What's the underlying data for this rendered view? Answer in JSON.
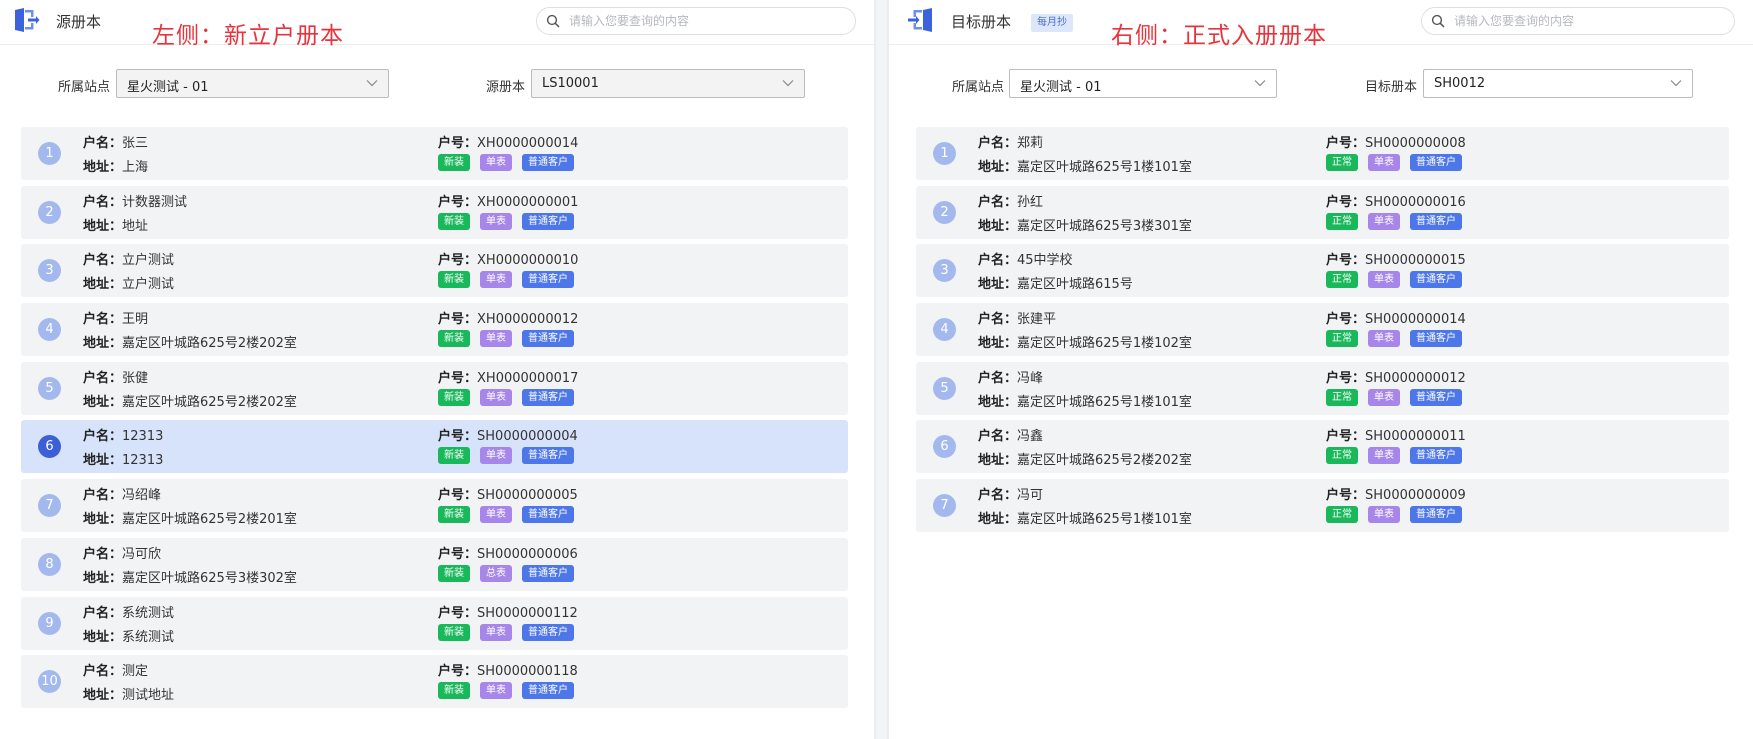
{
  "colors": {
    "annotation": "#e8333c",
    "status_tag": "#19b85a",
    "meter_tag": "#a786ea",
    "customer_tag": "#4d76e8",
    "selected_row": "#d6e3fb"
  },
  "labels": {
    "name": "户名：",
    "address": "地址：",
    "account": "户号："
  },
  "left": {
    "title": "源册本",
    "annotation": "左侧：新立户册本",
    "search_placeholder": "请输入您要查询的内容",
    "station_label": "所属站点",
    "station_value": "星火测试 - 01",
    "book_label": "源册本",
    "book_value": "LS10001",
    "rows": [
      {
        "index": "1",
        "name": "张三",
        "address": "上海",
        "account": "XH0000000014",
        "status": "新装",
        "meter": "单表",
        "customer": "普通客户",
        "selected": false
      },
      {
        "index": "2",
        "name": "计数器测试",
        "address": "地址",
        "account": "XH0000000001",
        "status": "新装",
        "meter": "单表",
        "customer": "普通客户",
        "selected": false
      },
      {
        "index": "3",
        "name": "立户测试",
        "address": "立户测试",
        "account": "XH0000000010",
        "status": "新装",
        "meter": "单表",
        "customer": "普通客户",
        "selected": false
      },
      {
        "index": "4",
        "name": "王明",
        "address": "嘉定区叶城路625号2楼202室",
        "account": "XH0000000012",
        "status": "新装",
        "meter": "单表",
        "customer": "普通客户",
        "selected": false
      },
      {
        "index": "5",
        "name": "张健",
        "address": "嘉定区叶城路625号2楼202室",
        "account": "XH0000000017",
        "status": "新装",
        "meter": "单表",
        "customer": "普通客户",
        "selected": false
      },
      {
        "index": "6",
        "name": "12313",
        "address": "12313",
        "account": "SH0000000004",
        "status": "新装",
        "meter": "单表",
        "customer": "普通客户",
        "selected": true
      },
      {
        "index": "7",
        "name": "冯绍峰",
        "address": "嘉定区叶城路625号2楼201室",
        "account": "SH0000000005",
        "status": "新装",
        "meter": "单表",
        "customer": "普通客户",
        "selected": false
      },
      {
        "index": "8",
        "name": "冯可欣",
        "address": "嘉定区叶城路625号3楼302室",
        "account": "SH0000000006",
        "status": "新装",
        "meter": "总表",
        "customer": "普通客户",
        "selected": false
      },
      {
        "index": "9",
        "name": "系统测试",
        "address": "系统测试",
        "account": "SH0000000112",
        "status": "新装",
        "meter": "单表",
        "customer": "普通客户",
        "selected": false
      },
      {
        "index": "10",
        "name": "测定",
        "address": "测试地址",
        "account": "SH0000000118",
        "status": "新装",
        "meter": "单表",
        "customer": "普通客户",
        "selected": false
      }
    ]
  },
  "right": {
    "title": "目标册本",
    "mode_tag": "每月抄",
    "annotation": "右侧：正式入册册本",
    "search_placeholder": "请输入您要查询的内容",
    "station_label": "所属站点",
    "station_value": "星火测试 - 01",
    "book_label": "目标册本",
    "book_value": "SH0012",
    "rows": [
      {
        "index": "1",
        "name": "郑莉",
        "address": "嘉定区叶城路625号1楼101室",
        "account": "SH0000000008",
        "status": "正常",
        "meter": "单表",
        "customer": "普通客户"
      },
      {
        "index": "2",
        "name": "孙红",
        "address": "嘉定区叶城路625号3楼301室",
        "account": "SH0000000016",
        "status": "正常",
        "meter": "单表",
        "customer": "普通客户"
      },
      {
        "index": "3",
        "name": "45中学校",
        "address": "嘉定区叶城路615号",
        "account": "SH0000000015",
        "status": "正常",
        "meter": "单表",
        "customer": "普通客户"
      },
      {
        "index": "4",
        "name": "张建平",
        "address": "嘉定区叶城路625号1楼102室",
        "account": "SH0000000014",
        "status": "正常",
        "meter": "单表",
        "customer": "普通客户"
      },
      {
        "index": "5",
        "name": "冯峰",
        "address": "嘉定区叶城路625号1楼101室",
        "account": "SH0000000012",
        "status": "正常",
        "meter": "单表",
        "customer": "普通客户"
      },
      {
        "index": "6",
        "name": "冯鑫",
        "address": "嘉定区叶城路625号2楼202室",
        "account": "SH0000000011",
        "status": "正常",
        "meter": "单表",
        "customer": "普通客户"
      },
      {
        "index": "7",
        "name": "冯可",
        "address": "嘉定区叶城路625号1楼101室",
        "account": "SH0000000009",
        "status": "正常",
        "meter": "单表",
        "customer": "普通客户"
      }
    ]
  }
}
